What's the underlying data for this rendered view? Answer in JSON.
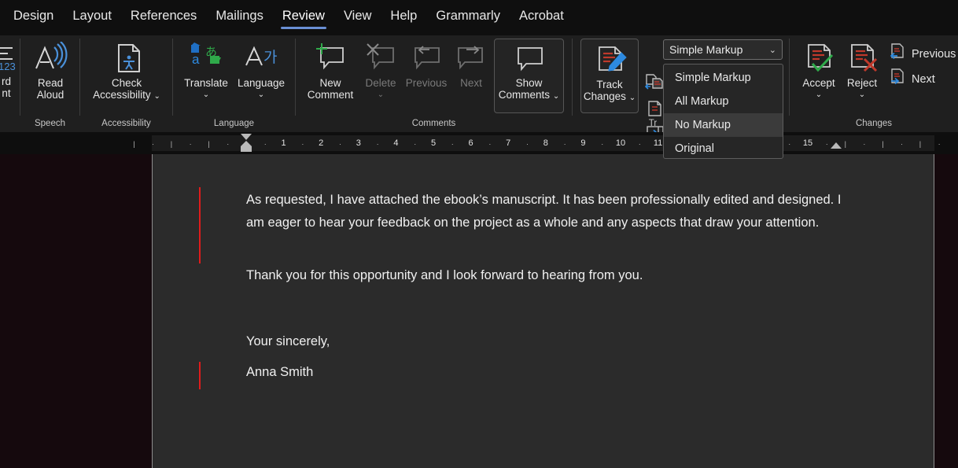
{
  "tabs": [
    {
      "label": "Design",
      "active": false
    },
    {
      "label": "Layout",
      "active": false
    },
    {
      "label": "References",
      "active": false
    },
    {
      "label": "Mailings",
      "active": false
    },
    {
      "label": "Review",
      "active": true
    },
    {
      "label": "View",
      "active": false
    },
    {
      "label": "Help",
      "active": false
    },
    {
      "label": "Grammarly",
      "active": false
    },
    {
      "label": "Acrobat",
      "active": false
    }
  ],
  "ribbon": {
    "groups": [
      {
        "name": "Speech",
        "label": "Speech"
      },
      {
        "name": "Accessibility",
        "label": "Accessibility"
      },
      {
        "name": "Language",
        "label": "Language"
      },
      {
        "name": "Comments",
        "label": "Comments"
      },
      {
        "name": "Tracking",
        "label": "Tr"
      },
      {
        "name": "Changes",
        "label": "Changes"
      }
    ],
    "buttons": {
      "word_count_line1": "rd",
      "word_count_line2": "nt",
      "read_aloud_line1": "Read",
      "read_aloud_line2": "Aloud",
      "check_accessibility_line1": "Check",
      "check_accessibility_line2": "Accessibility",
      "translate": "Translate",
      "language": "Language",
      "new_comment_line1": "New",
      "new_comment_line2": "Comment",
      "delete": "Delete",
      "previous_comment": "Previous",
      "next_comment": "Next",
      "show_comments_line1": "Show",
      "show_comments_line2": "Comments",
      "track_changes_line1": "Track",
      "track_changes_line2": "Changes",
      "accept": "Accept",
      "reject": "Reject",
      "previous_change": "Previous",
      "next_change": "Next"
    }
  },
  "markup_combo": {
    "selected": "Simple Markup",
    "arrow": "⌄",
    "options": [
      {
        "label": "Simple Markup",
        "highlighted": false
      },
      {
        "label": "All Markup",
        "highlighted": false
      },
      {
        "label": "No Markup",
        "highlighted": true
      },
      {
        "label": "Original",
        "highlighted": false
      }
    ]
  },
  "ruler": {
    "numbers": [
      "1",
      "2",
      "3",
      "4",
      "5",
      "6",
      "7",
      "8",
      "9",
      "10",
      "11",
      "15"
    ]
  },
  "document": {
    "paragraphs": [
      "As requested, I have attached the ebook’s manuscript. It has been professionally edited and designed. I am eager to hear your feedback on the project as a whole and any aspects that draw your attention.",
      "Thank you for this opportunity and I look forward to hearing from you.",
      "Your sincerely,",
      "Anna Smith"
    ]
  },
  "colors": {
    "accent": "#6a8fd4",
    "change_bar": "#e01b1b",
    "ribbon_bg": "#1f1f1f",
    "page_bg": "#2b2b2b"
  }
}
